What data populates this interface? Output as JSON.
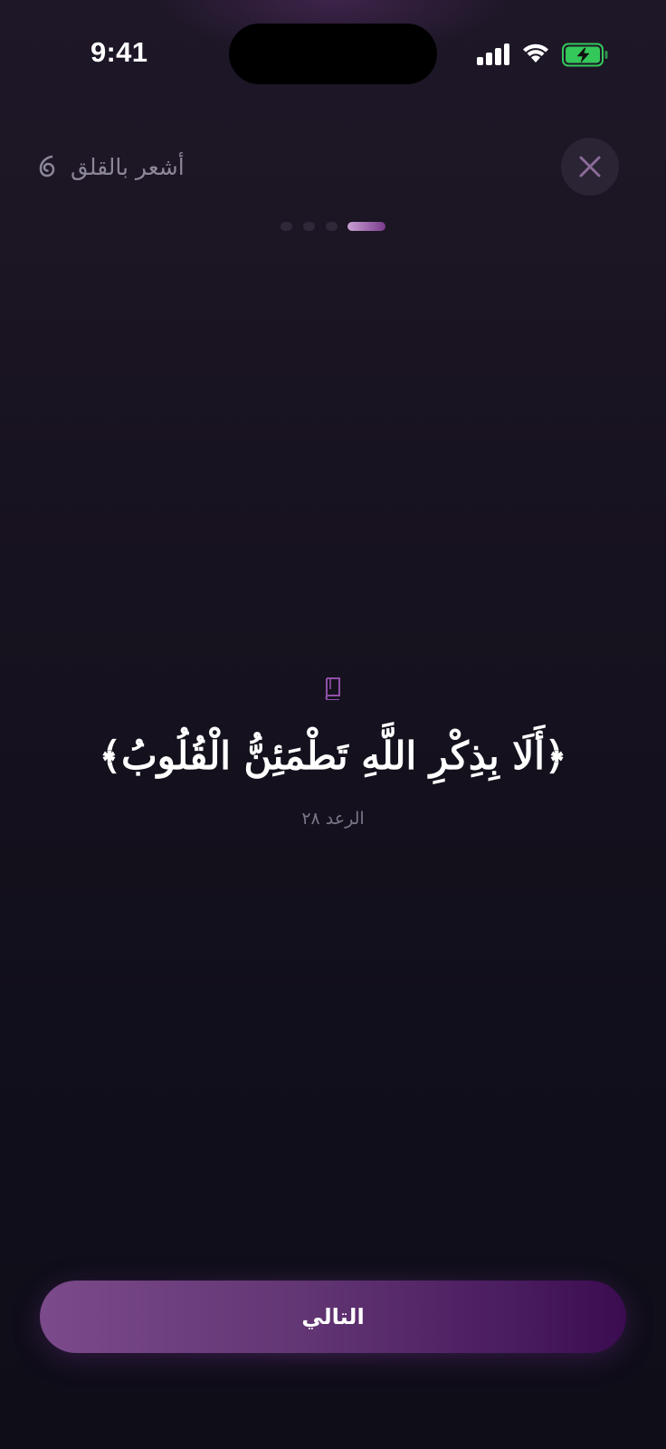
{
  "status_bar": {
    "time": "9:41",
    "icons": [
      "signal-icon",
      "wifi-icon",
      "battery-charging-icon"
    ],
    "battery_color": "#34c759"
  },
  "header": {
    "mood_label": "أشعر بالقلق",
    "mood_icon": "swirl-icon",
    "close_icon": "close-icon"
  },
  "progress": {
    "total_steps": 4,
    "current_step": 1
  },
  "verse": {
    "icon": "book-icon",
    "text": "﴿أَلَا بِذِكْرِ اللَّهِ تَطْمَئِنُّ الْقُلُوبُ﴾",
    "reference": "الرعد ٢٨"
  },
  "actions": {
    "next_label": "التالي"
  },
  "colors": {
    "accent": "#7b4a8a",
    "accent_dark": "#3b0c50",
    "background": "#110f1b",
    "muted_text": "#8c8699"
  }
}
